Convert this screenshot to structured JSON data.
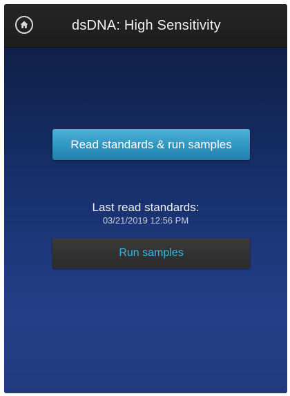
{
  "header": {
    "title": "dsDNA: High Sensitivity",
    "home_icon": "home-icon"
  },
  "main": {
    "primary_button_label": "Read standards & run samples",
    "status_label": "Last read standards:",
    "status_datetime": "03/21/2019 12:56 PM",
    "secondary_button_label": "Run samples"
  },
  "colors": {
    "header_bg": "#1f1f1f",
    "background_top": "#0d1b3c",
    "background_bottom": "#243f88",
    "primary_button": "#3399c6",
    "secondary_button": "#2f2f2f",
    "secondary_button_text": "#3ab7e3"
  }
}
